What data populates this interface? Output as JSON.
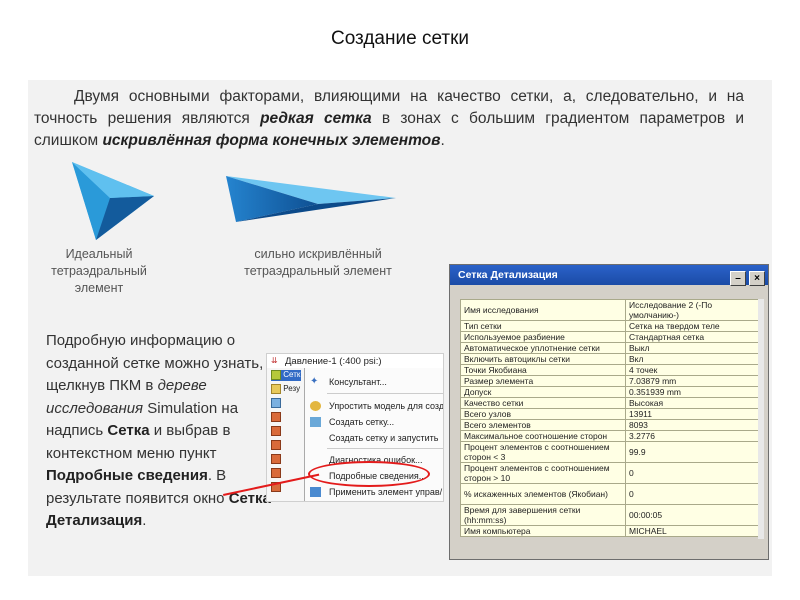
{
  "title": "Создание сетки",
  "intro": {
    "part1": "Двумя основными факторами, влияющими на качество сетки, а, следовательно, и на точность решения являются ",
    "em1": "редкая сетка",
    "part2": " в зонах с большим градиентом параметров и слишком ",
    "em2": "искривлённая форма конечных элементов",
    "part3": "."
  },
  "captions": {
    "ideal": [
      "Идеальный",
      "тетраэдральный",
      "элемент"
    ],
    "distorted": [
      "сильно искривлённый",
      "тетраэдральный элемент"
    ]
  },
  "body": {
    "t1": "Подробную информацию о созданной сетке можно узнать, щелкнув ПКМ в ",
    "t2": "дереве исследования",
    "t3": " Simulation на надпись ",
    "t4": "Сетка",
    "t5": " и выбрав в контекстном меню пункт ",
    "t6": "Подробные сведения",
    "t7": ". В результате появится окно ",
    "t8": "Сетка Детализация",
    "t9": "."
  },
  "menu_shot": {
    "tree_header": "Давление-1 (:400 psi:)",
    "tree_nodes": [
      "Сетк",
      "Резу",
      "",
      "",
      "",
      "",
      "",
      "",
      ""
    ],
    "items": [
      "Консультант...",
      "Упростить модель для созд",
      "Создать сетку...",
      "Создать сетку и запустить",
      "Диагностика ошибок...",
      "Подробные сведения...",
      "Применить элемент управ/"
    ]
  },
  "dialog": {
    "title": "Сетка Детализация",
    "buttons": [
      "–",
      "×"
    ],
    "rows": [
      {
        "key": "Имя исследования",
        "value": "Исследование 2 (-По умолчанию-)",
        "tall": false
      },
      {
        "key": "Тип сетки",
        "value": "Сетка на твердом теле",
        "tall": false
      },
      {
        "key": "Используемое разбиение",
        "value": "Стандартная сетка",
        "tall": false
      },
      {
        "key": "Автоматическое уплотнение сетки",
        "value": "Выкл",
        "tall": false
      },
      {
        "key": "Включить автоциклы сетки",
        "value": "Вкл",
        "tall": false
      },
      {
        "key": "Точки Якобиана",
        "value": "4 точек",
        "tall": false
      },
      {
        "key": "Размер элемента",
        "value": "7.03879 mm",
        "tall": false
      },
      {
        "key": "Допуск",
        "value": "0.351939 mm",
        "tall": false
      },
      {
        "key": "Качество сетки",
        "value": "Высокая",
        "tall": false
      },
      {
        "key": "Всего узлов",
        "value": "13911",
        "tall": false
      },
      {
        "key": "Всего элементов",
        "value": "8093",
        "tall": false
      },
      {
        "key": "Максимальное соотношение сторон",
        "value": "3.2776",
        "tall": false
      },
      {
        "key": "Процент элементов с соотношением сторон < 3",
        "value": "99.9",
        "tall": true
      },
      {
        "key": "Процент элементов с соотношением сторон > 10",
        "value": "0",
        "tall": true
      },
      {
        "key": "% искаженных элементов (Якобиан)",
        "value": "0",
        "tall": true
      },
      {
        "key": "Время для завершения сетки (hh:mm:ss)",
        "value": "00:00:05",
        "tall": false
      },
      {
        "key": "Имя компьютера",
        "value": "MICHAEL",
        "tall": false
      }
    ]
  },
  "colors": {
    "accent_red": "#e31b1b",
    "tetra_blue": "#1a6fc0",
    "dialog_title": "#2b62c9"
  }
}
